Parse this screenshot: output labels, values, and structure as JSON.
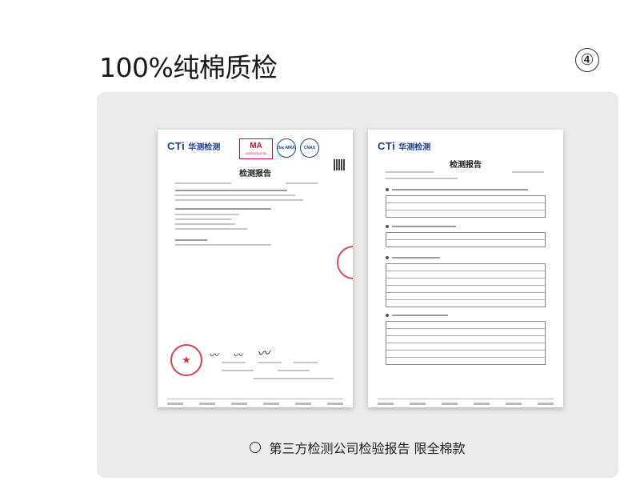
{
  "header": {
    "title": "100%纯棉质检",
    "step": "④"
  },
  "documents": [
    {
      "logo_text": "CTi",
      "logo_cn": "华测检测",
      "cma_label": "MA",
      "cma_number": "240020349784",
      "cert_a": "ilac-MRA",
      "cert_b": "CNAS",
      "title": "检测报告"
    },
    {
      "logo_text": "CTi",
      "logo_cn": "华测检测",
      "title": "检测报告"
    }
  ],
  "caption": {
    "text": "第三方检测公司检验报告 限全棉款"
  }
}
